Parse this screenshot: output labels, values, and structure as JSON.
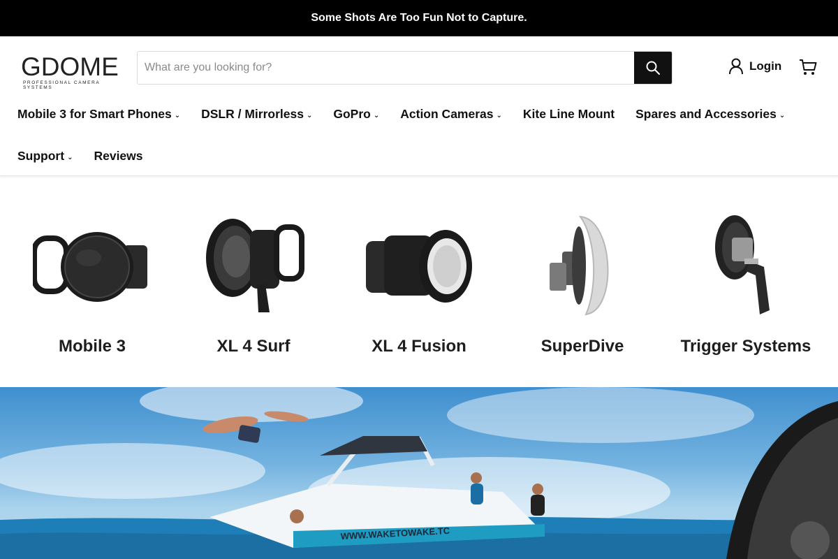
{
  "announcement": "Some Shots Are Too Fun Not to Capture.",
  "logo": {
    "main": "GDOME",
    "sub": "PROFESSIONAL CAMERA SYSTEMS"
  },
  "search": {
    "placeholder": "What are you looking for?",
    "value": ""
  },
  "account": {
    "login_label": "Login"
  },
  "nav": {
    "row1": [
      {
        "label": "Mobile 3 for Smart Phones",
        "dropdown": true
      },
      {
        "label": "DSLR / Mirrorless",
        "dropdown": true
      },
      {
        "label": "GoPro",
        "dropdown": true
      },
      {
        "label": "Action Cameras",
        "dropdown": true
      },
      {
        "label": "Kite Line Mount",
        "dropdown": false
      },
      {
        "label": "Spares and Accessories",
        "dropdown": true
      }
    ],
    "row2": [
      {
        "label": "Support",
        "dropdown": true
      },
      {
        "label": "Reviews",
        "dropdown": false
      }
    ]
  },
  "caret_glyph": "⌄",
  "products": [
    {
      "label": "Mobile 3"
    },
    {
      "label": "XL 4 Surf"
    },
    {
      "label": "XL 4 Fusion"
    },
    {
      "label": "SuperDive"
    },
    {
      "label": "Trigger Systems"
    }
  ],
  "hero": {
    "boat_text": "WWW.WAKETOWAKE.TC"
  },
  "colors": {
    "announcement_bg": "#000000",
    "search_button_bg": "#111111",
    "text": "#111111"
  }
}
